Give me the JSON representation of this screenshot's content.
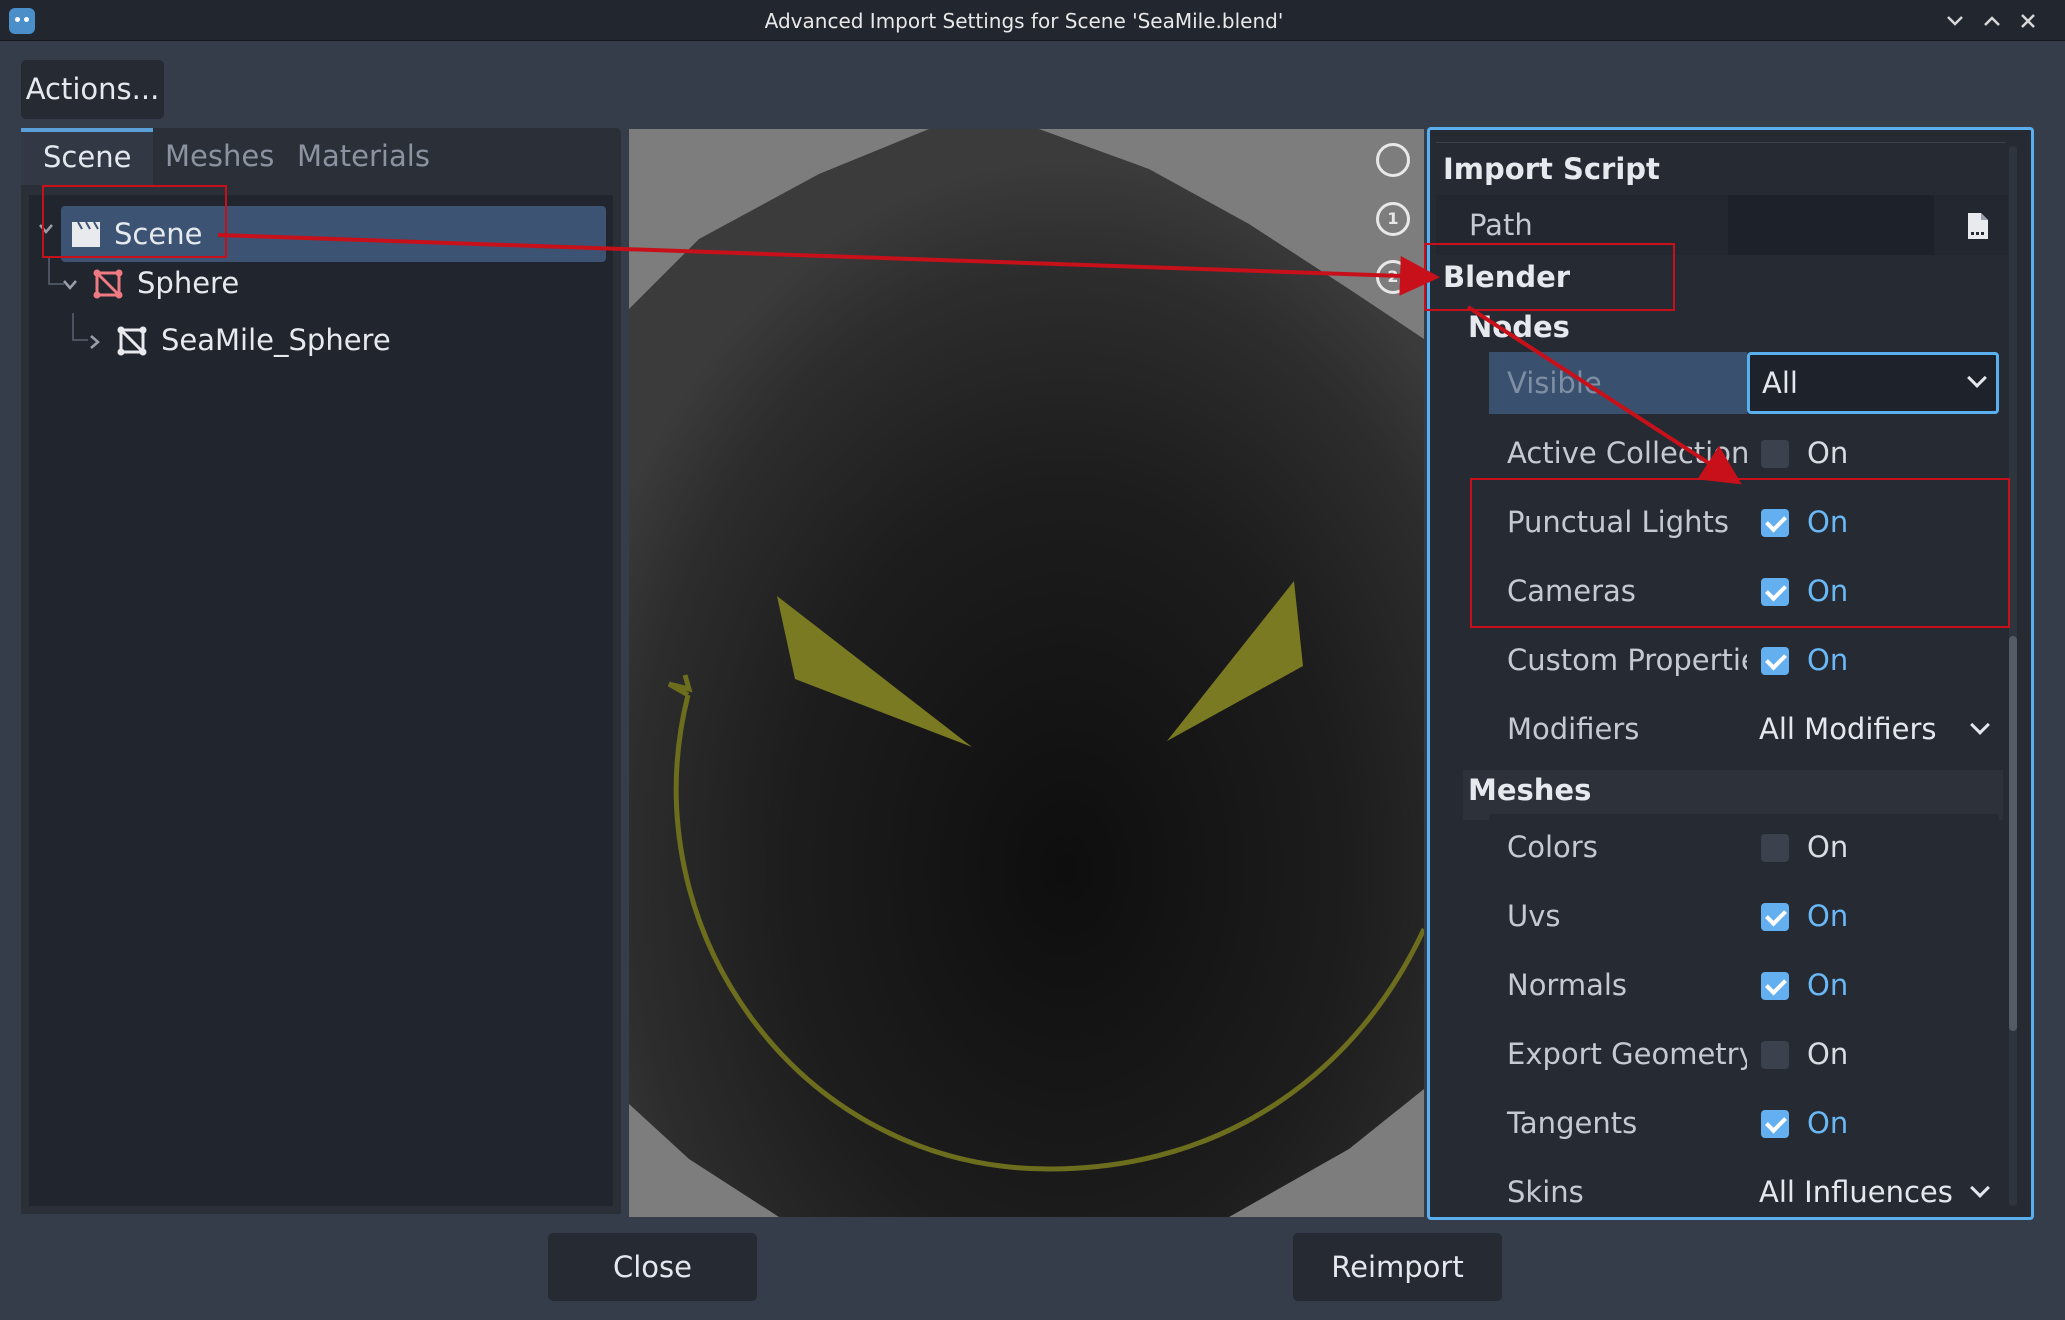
{
  "window": {
    "title": "Advanced Import Settings for Scene 'SeaMile.blend'",
    "controls": [
      "chevron-down",
      "chevron-up",
      "close"
    ]
  },
  "toolbar": {
    "actions_label": "Actions..."
  },
  "tabs": [
    {
      "label": "Scene",
      "active": true
    },
    {
      "label": "Meshes",
      "active": false
    },
    {
      "label": "Materials",
      "active": false
    }
  ],
  "tree": [
    {
      "label": "Scene",
      "icon": "clapperboard-icon",
      "selected": true
    },
    {
      "label": "Sphere",
      "icon": "mesh-instance-icon"
    },
    {
      "label": "SeaMile_Sphere",
      "icon": "mesh-instance-icon"
    }
  ],
  "inspector": {
    "import_script": {
      "title": "Import Script",
      "path_label": "Path",
      "path_value": ""
    },
    "blender": {
      "title": "Blender",
      "nodes": {
        "title": "Nodes",
        "visible_label": "Visible",
        "visible_value": "All",
        "active_collection": {
          "label": "Active Collection",
          "checked": false,
          "text": "On"
        },
        "punctual_lights": {
          "label": "Punctual Lights",
          "checked": true,
          "text": "On"
        },
        "cameras": {
          "label": "Cameras",
          "checked": true,
          "text": "On"
        },
        "custom_properties": {
          "label": "Custom Propertie",
          "checked": true,
          "text": "On"
        },
        "modifiers": {
          "label": "Modifiers",
          "value": "All Modifiers"
        }
      },
      "meshes": {
        "title": "Meshes",
        "colors": {
          "label": "Colors",
          "checked": false,
          "text": "On"
        },
        "uvs": {
          "label": "Uvs",
          "checked": true,
          "text": "On"
        },
        "normals": {
          "label": "Normals",
          "checked": true,
          "text": "On"
        },
        "export_geometry": {
          "label": "Export Geometry",
          "checked": false,
          "text": "On"
        },
        "tangents": {
          "label": "Tangents",
          "checked": true,
          "text": "On"
        },
        "skins": {
          "label": "Skins",
          "value": "All Influences"
        }
      }
    }
  },
  "footer": {
    "close_label": "Close",
    "reimport_label": "Reimport"
  },
  "colors": {
    "accent": "#5ab0ee",
    "checkbox_on": "#63aff0",
    "annotation_red": "#c8101a",
    "face_yellow": "#7a7a22"
  }
}
